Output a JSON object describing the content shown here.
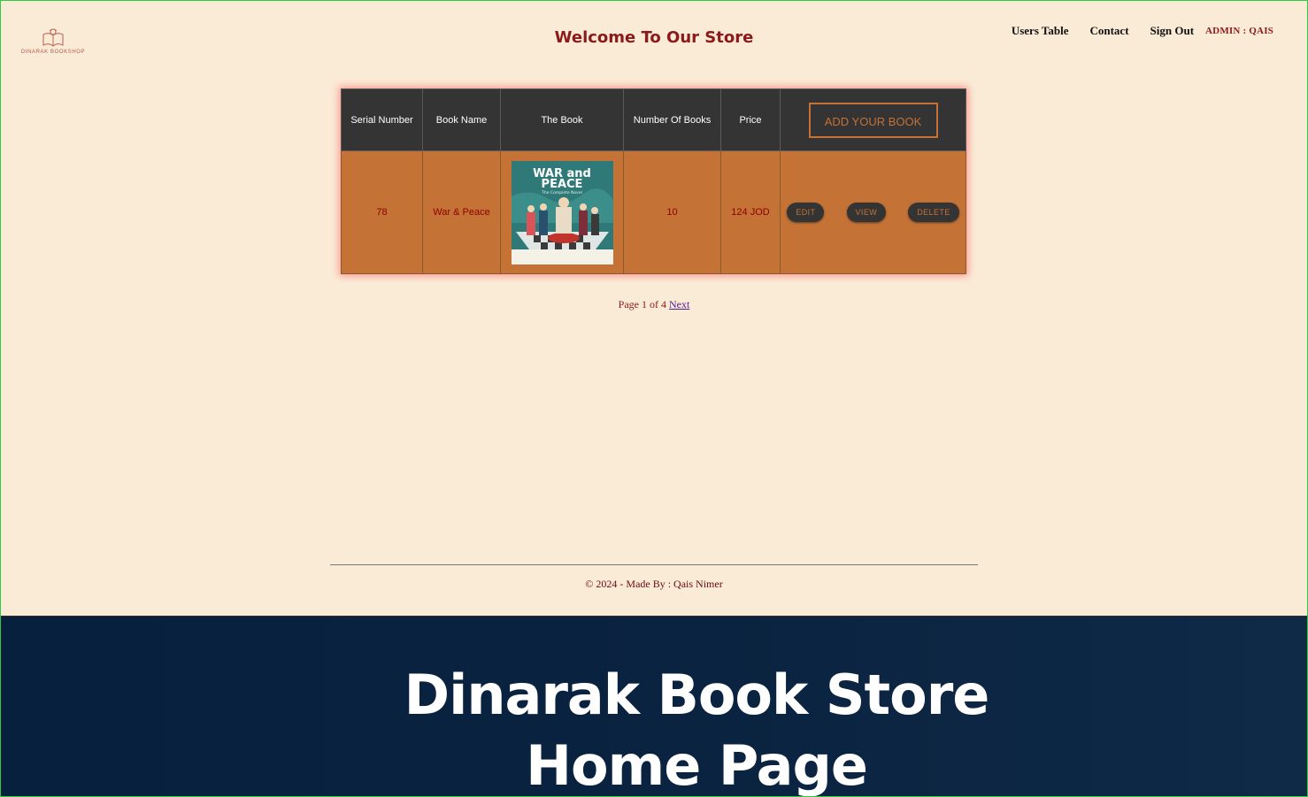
{
  "header": {
    "logo_text": "DINARAK BOOKSHOP",
    "title": "Welcome To Our Store",
    "nav": {
      "users_table": "Users Table",
      "contact": "Contact",
      "sign_out": "Sign Out",
      "admin": "ADMIN : QAIS"
    }
  },
  "table": {
    "columns": [
      "Serial Number",
      "Book Name",
      "The Book",
      "Number Of Books",
      "Price"
    ],
    "add_button": "ADD YOUR BOOK",
    "rows": [
      {
        "serial": "78",
        "name": "War & Peace",
        "cover": {
          "title_line1": "WAR and",
          "title_line2": "PEACE",
          "subtitle": "The Complete Novel"
        },
        "count": "10",
        "price": "124 JOD",
        "actions": {
          "edit": "EDIT",
          "view": "VIEW",
          "delete": "DELETE"
        }
      }
    ]
  },
  "pagination": {
    "text": "Page 1 of 4",
    "next": "Next"
  },
  "footer": {
    "text": "© 2024 - Made By : Qais Nimer"
  },
  "banner": {
    "line1": "Dinarak Book Store",
    "line2": "Home Page"
  },
  "colors": {
    "page_bg": "#faebd7",
    "header_bg": "#343434",
    "row_bg": "#c47236",
    "accent_text": "#8b1a1a",
    "banner_bg": "#0a2340"
  }
}
